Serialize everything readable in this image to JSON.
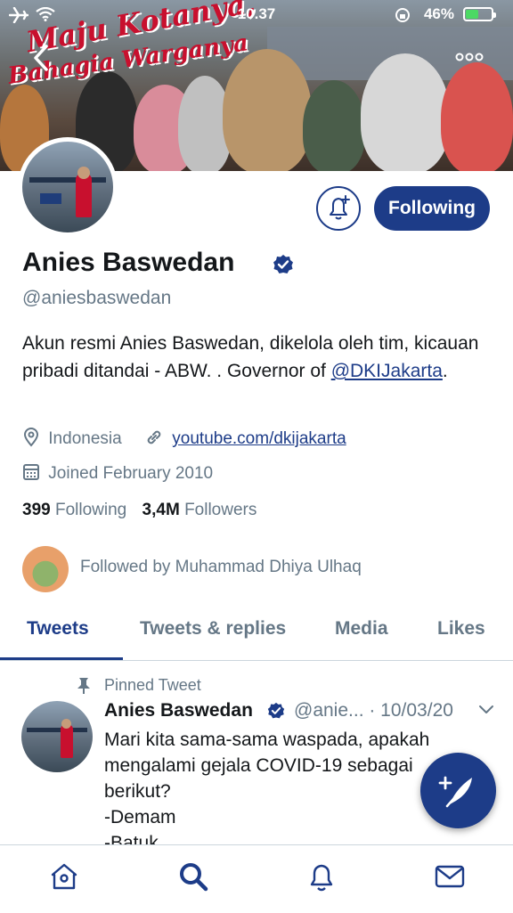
{
  "status_bar": {
    "time": "10.37",
    "battery": "46%"
  },
  "banner": {
    "line1": "Maju Kotanya,",
    "line2": "Bahagia Warganya"
  },
  "header": {
    "back_icon": "chevron-left-icon",
    "more_icon": "more-horizontal-icon"
  },
  "profile": {
    "name": "Anies Baswedan",
    "handle": "@aniesbaswedan",
    "bio_text": "Akun resmi Anies Baswedan, dikelola oleh tim, kicauan pribadi ditandai - ABW. . Governor of ",
    "bio_link": "@DKIJakarta",
    "bio_end": ".",
    "location": "Indonesia",
    "website": "youtube.com/dkijakarta",
    "joined": "Joined February 2010",
    "following_count": "399",
    "following_label": "Following",
    "followers_count": "3,4M",
    "followers_label": "Followers",
    "followed_by": "Followed by Muhammad Dhiya Ulhaq"
  },
  "actions": {
    "following_button": "Following",
    "notify_icon": "bell-plus-icon"
  },
  "tabs": [
    {
      "label": "Tweets",
      "active": true
    },
    {
      "label": "Tweets & replies",
      "active": false
    },
    {
      "label": "Media",
      "active": false
    },
    {
      "label": "Likes",
      "active": false
    }
  ],
  "pinned_tweet": {
    "pinned_label": "Pinned Tweet",
    "name": "Anies Baswedan",
    "handle_date": "@anie... · 10/03/20",
    "text": "Mari kita sama-sama waspada, apakah\nmengalami gejala COVID-19 sebagai\nberikut?\n-Demam\n-Batuk"
  },
  "bottom_nav": [
    {
      "icon": "home-icon",
      "active": false
    },
    {
      "icon": "search-icon",
      "active": true
    },
    {
      "icon": "notifications-icon",
      "active": false
    },
    {
      "icon": "messages-icon",
      "active": false
    }
  ],
  "colors": {
    "accent": "#1d3c88",
    "secondary_text": "#657786",
    "battery": "#4cd964"
  }
}
